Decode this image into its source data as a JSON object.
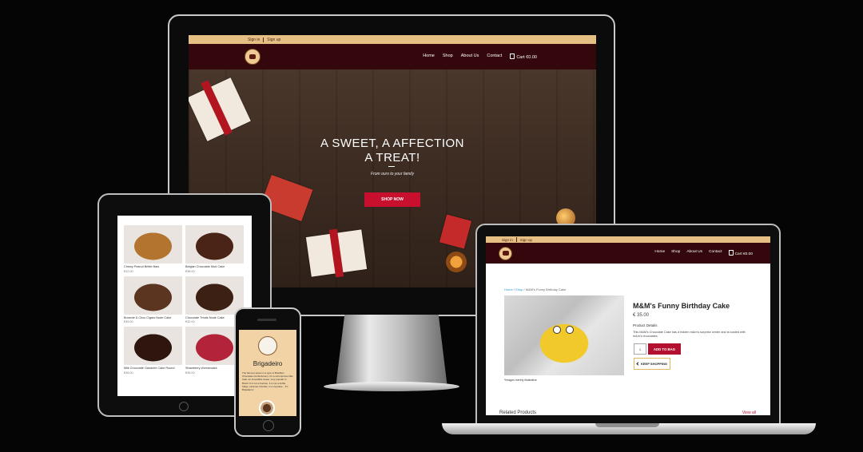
{
  "desktop": {
    "topbar": {
      "sign_in": "Sign in",
      "sign_up": "Sign up"
    },
    "nav": {
      "home": "Home",
      "shop": "Shop",
      "about": "About Us",
      "contact": "Contact",
      "cart": "Cart €0.00"
    },
    "hero": {
      "title_line1": "A SWEET, A AFFECTION",
      "title_line2": "A TREAT!",
      "subtitle": "From ours to your family",
      "cta": "SHOP NOW"
    }
  },
  "tablet": {
    "products": [
      {
        "name": "Chewy Peanut Brittle Bars",
        "price": "€12.00",
        "color": "#b3742f"
      },
      {
        "name": "Belgian Chocolate Mud Cake",
        "price": "€38.00",
        "color": "#4a2416"
      },
      {
        "name": "Brownie & Choc Cigars Nude Cake",
        "price": "€39.00",
        "color": "#5b3520"
      },
      {
        "name": "Chocolate Treats Nude Cake",
        "price": "€32.00",
        "color": "#3d2014"
      },
      {
        "name": "Milk Chocolate Ganache Cake Round",
        "price": "€36.00",
        "color": "#2e160e"
      },
      {
        "name": "Strawberry cheesecake",
        "price": "€35.00",
        "color": "#b3243b"
      }
    ]
  },
  "phone": {
    "title": "Brigadeiro",
    "text": "The famous sweet in a type of Brazilian Chocolate Confectionery. It's a scrumptious little treat, an irresistible sweet, very popular in Brazil. It is not a bonbon, it is not a truffle, fudge, caramel, biscuits, or a cupcake... It's Brigadeiro!"
  },
  "laptop": {
    "topbar": {
      "sign_in": "Sign in",
      "sign_up": "Sign up"
    },
    "nav": {
      "home": "Home",
      "shop": "Shop",
      "about": "About Us",
      "contact": "Contact",
      "cart": "Cart €0.00"
    },
    "breadcrumb": {
      "home": "Home",
      "shop": "Shop",
      "current": "M&M's Funny Birthday Cake"
    },
    "product": {
      "title": "M&M's Funny Birthday Cake",
      "price": "€ 35.00",
      "details_heading": "Product Details",
      "description": "This M&M's Chocolate Cake has a hidden m&m's surprise center and is loaded with m&m's chocolates.",
      "quantity": "1",
      "add_to_bag": "ADD TO BAG",
      "keep_shopping": "KEEP SHOPPING",
      "image_note": "*Images merely illustrative"
    },
    "related": {
      "heading": "Related Products",
      "view_all": "View all"
    }
  },
  "colors": {
    "accent": "#c8102e",
    "navbar": "#33070b",
    "topbar": "#e6bf85"
  }
}
